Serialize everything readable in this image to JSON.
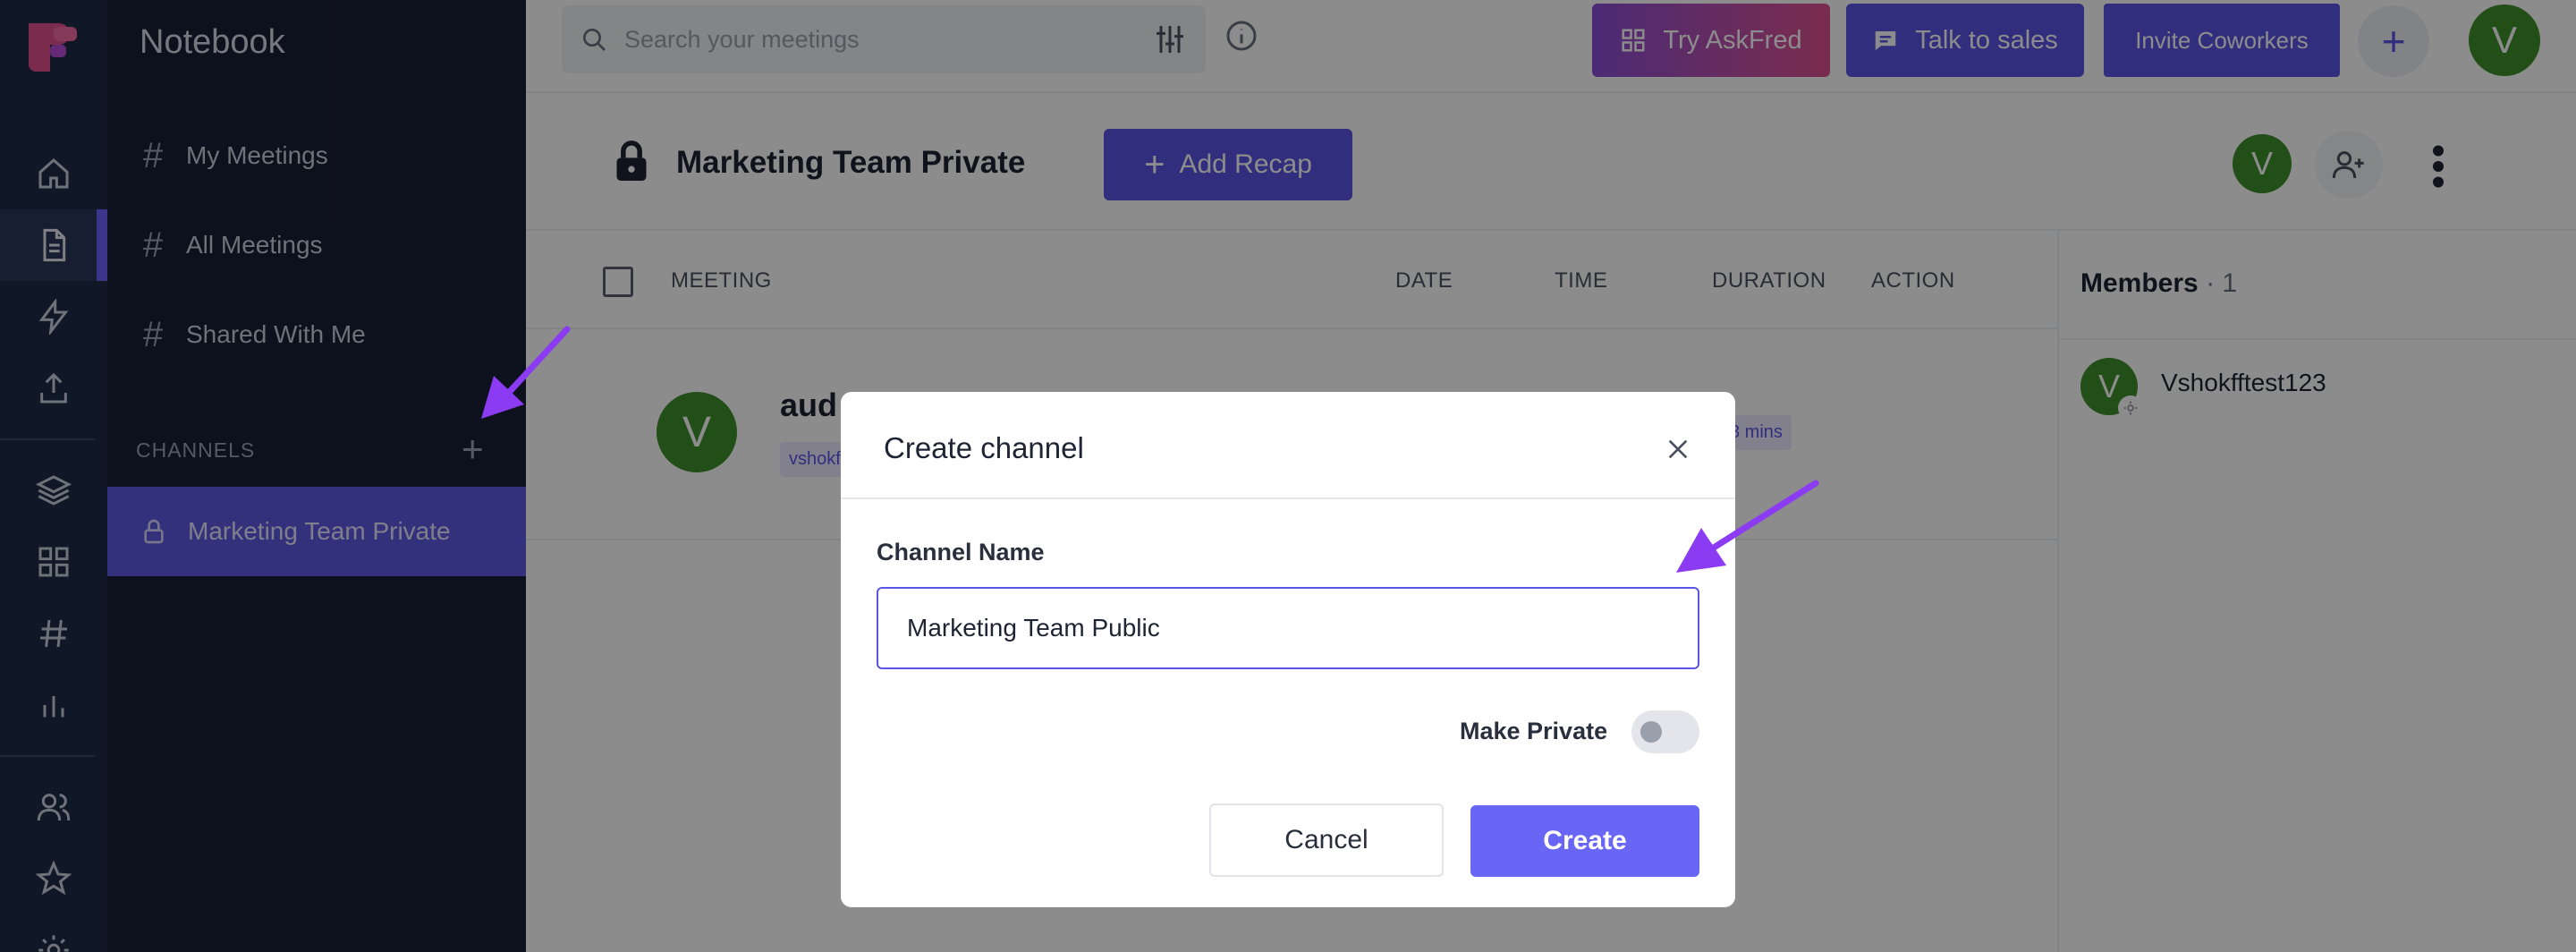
{
  "app": {
    "sidebar_title": "Notebook",
    "accent": "#5a55e3"
  },
  "rail": {
    "icons": [
      "logo-icon",
      "home-icon",
      "notebook-icon",
      "lightning-icon",
      "upload-icon",
      "layers-icon",
      "apps-grid-icon",
      "hash-icon",
      "analytics-icon",
      "people-icon",
      "star-icon",
      "gear-icon"
    ]
  },
  "sidebar": {
    "items": [
      {
        "label": "My Meetings"
      },
      {
        "label": "All Meetings"
      },
      {
        "label": "Shared With Me"
      }
    ],
    "channels_header": "CHANNELS",
    "active_channel": "Marketing Team Private"
  },
  "topbar": {
    "search_placeholder": "Search your meetings",
    "try_askfred": "Try AskFred",
    "talk_to_sales": "Talk to sales",
    "invite_coworkers": "Invite Coworkers",
    "avatar_initial": "V"
  },
  "channel": {
    "title": "Marketing Team Private",
    "add_recap": "Add Recap",
    "member_initial": "V"
  },
  "table": {
    "columns": [
      "MEETING",
      "DATE",
      "TIME",
      "DURATION",
      "ACTION"
    ],
    "rows": [
      {
        "initial": "V",
        "title": "aud",
        "tag": "vshokf",
        "duration": "3 mins"
      }
    ]
  },
  "members": {
    "heading": "Members",
    "count": "· 1",
    "list": [
      {
        "initial": "V",
        "name": "Vshokfftest123"
      }
    ]
  },
  "modal": {
    "title": "Create channel",
    "field_label": "Channel Name",
    "field_value": "Marketing Team Public",
    "private_label": "Make Private",
    "private_on": false,
    "cancel": "Cancel",
    "create": "Create"
  }
}
